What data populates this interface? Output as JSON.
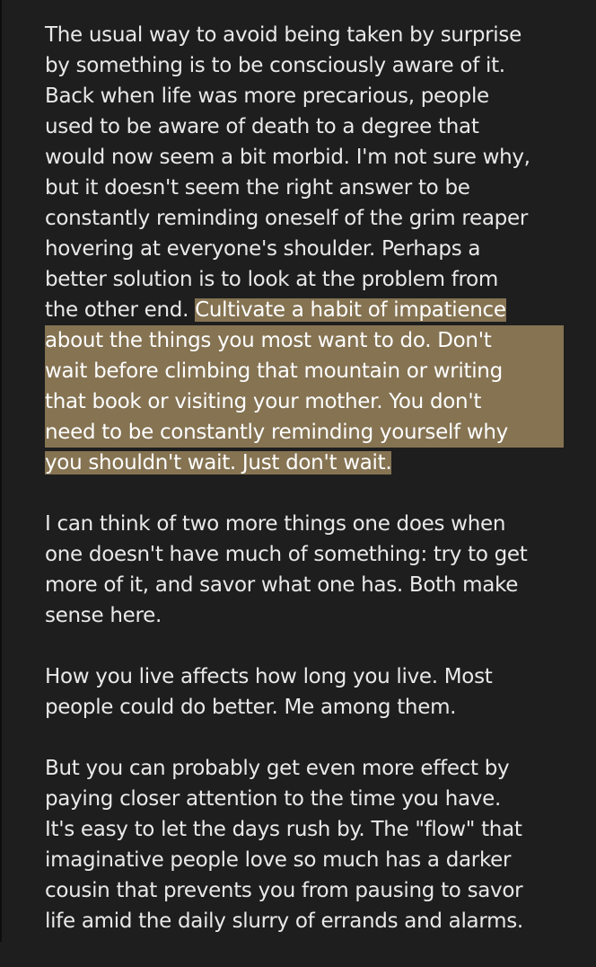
{
  "paragraphs": [
    {
      "lines": [
        "The usual way to avoid being taken by surprise",
        "by something is to be consciously aware of it.",
        "Back when life was more precarious, people",
        "used to be aware of death to a degree that",
        "would now seem a bit morbid. I'm not sure why,",
        "but it doesn't seem the right answer to be",
        "constantly reminding oneself of the grim reaper",
        "hovering at everyone's shoulder. Perhaps a",
        "better solution is to look at the problem from"
      ],
      "mixed_line": {
        "plain": "the other end. ",
        "highlighted": "Cultivate a habit of impatience"
      },
      "highlighted_lines": [
        "about the things you most want to do. Don't",
        "wait before climbing that mountain or writing",
        "that book or visiting your mother. You don't",
        "need to be constantly reminding yourself why"
      ],
      "highlighted_last": "you shouldn't wait. Just don't wait."
    },
    {
      "lines": [
        "I can think of two more things one does when",
        "one doesn't have much of something: try to get",
        "more of it, and savor what one has. Both make",
        "sense here."
      ]
    },
    {
      "lines": [
        "How you live affects how long you live. Most",
        "people could do better. Me among them."
      ]
    },
    {
      "lines": [
        "But you can probably get even more effect by",
        "paying closer attention to the time you have.",
        "It's easy to let the days rush by. The \"flow\" that",
        "imaginative people love so much has a darker",
        "cousin that prevents you from pausing to savor",
        "life amid the daily slurry of errands and alarms."
      ]
    }
  ],
  "colors": {
    "background": "#1e1e1e",
    "text": "#e9e9e9",
    "highlight": "#857352"
  }
}
